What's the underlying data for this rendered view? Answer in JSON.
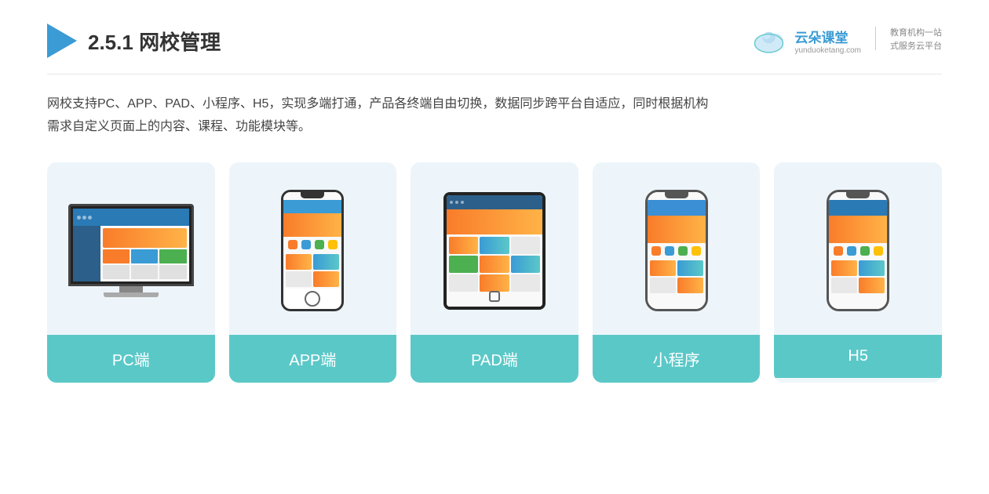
{
  "header": {
    "title_prefix": "2.5.1 ",
    "title_main": "网校管理",
    "brand": {
      "name": "云朵课堂",
      "url": "yunduoketang.com",
      "slogan_line1": "教育机构一站",
      "slogan_line2": "式服务云平台"
    }
  },
  "description": {
    "text_line1": "网校支持PC、APP、PAD、小程序、H5，实现多端打通，产品各终端自由切换，数据同步跨平台自适应，同时根据机构",
    "text_line2": "需求自定义页面上的内容、课程、功能模块等。"
  },
  "cards": [
    {
      "id": "pc",
      "label": "PC端",
      "label_color": "#5bc8c8"
    },
    {
      "id": "app",
      "label": "APP端",
      "label_color": "#5bc8c8"
    },
    {
      "id": "pad",
      "label": "PAD端",
      "label_color": "#5bc8c8"
    },
    {
      "id": "miniprogram",
      "label": "小程序",
      "label_color": "#5bc8c8"
    },
    {
      "id": "h5",
      "label": "H5",
      "label_color": "#5bc8c8"
    }
  ]
}
